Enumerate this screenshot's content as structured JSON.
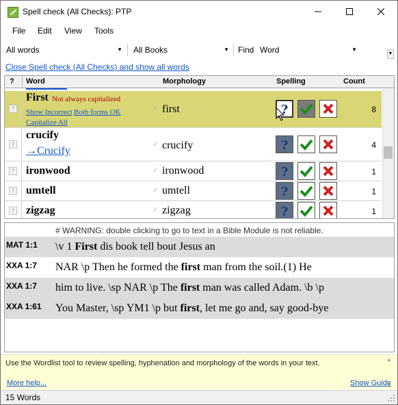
{
  "window": {
    "title": "Spell check (All Checks): PTP"
  },
  "menu": [
    "File",
    "Edit",
    "View",
    "Tools"
  ],
  "filters": {
    "words": "All words",
    "books": "All Books",
    "find_label": "Find",
    "find_mode": "Word"
  },
  "close_link": "Close Spell check (All Checks) and show all words",
  "grid": {
    "headers": {
      "q": "?",
      "word": "Word",
      "morphology": "Morphology",
      "spelling": "Spelling",
      "count": "Count"
    },
    "rows": [
      {
        "word": "First",
        "note": "Not always capitalized",
        "links": [
          "Show Incorrect",
          "Both forms OK",
          "Capitalize All"
        ],
        "morphology": "first",
        "count": "8",
        "selected": true
      },
      {
        "word": "crucify",
        "link": "→Crucify",
        "morphology": "crucify",
        "count": "4"
      },
      {
        "word": "ironwood",
        "morphology": "ironwood",
        "count": "1"
      },
      {
        "word": "umtell",
        "morphology": "umtell",
        "count": "1"
      },
      {
        "word": "zigzag",
        "morphology": "zigzag",
        "count": "1"
      }
    ]
  },
  "context": {
    "warning": "# WARNING: double clicking to go to text in a Bible Module is not reliable.",
    "rows": [
      {
        "ref": "MAT  1:1",
        "pre": "\\v 1 ",
        "hit": "First",
        "post": " dis book tell bout Jesus an"
      },
      {
        "ref": "XXA  1:7",
        "pre": "NAR \\p Then he formed the ",
        "hit": "first",
        "post": " man from the soil.(1) He"
      },
      {
        "ref": "XXA  1:7",
        "pre": "him to live. \\sp NAR \\p The ",
        "hit": "first",
        "post": " man was called Adam. \\b \\p"
      },
      {
        "ref": "XXA  1:61",
        "pre": "You Master, \\sp YM1 \\p but ",
        "hit": "first",
        "post": ", let me go and, say good-bye"
      }
    ]
  },
  "help": {
    "text": "Use the Wordlist tool to review spelling, hyphenation and morphology of the words in your text.",
    "more_help": "More help...",
    "show_guide": "Show Guide"
  },
  "status": "15 Words",
  "icons": {
    "question": "question-icon",
    "ok": "check-icon",
    "wrong": "x-icon"
  }
}
